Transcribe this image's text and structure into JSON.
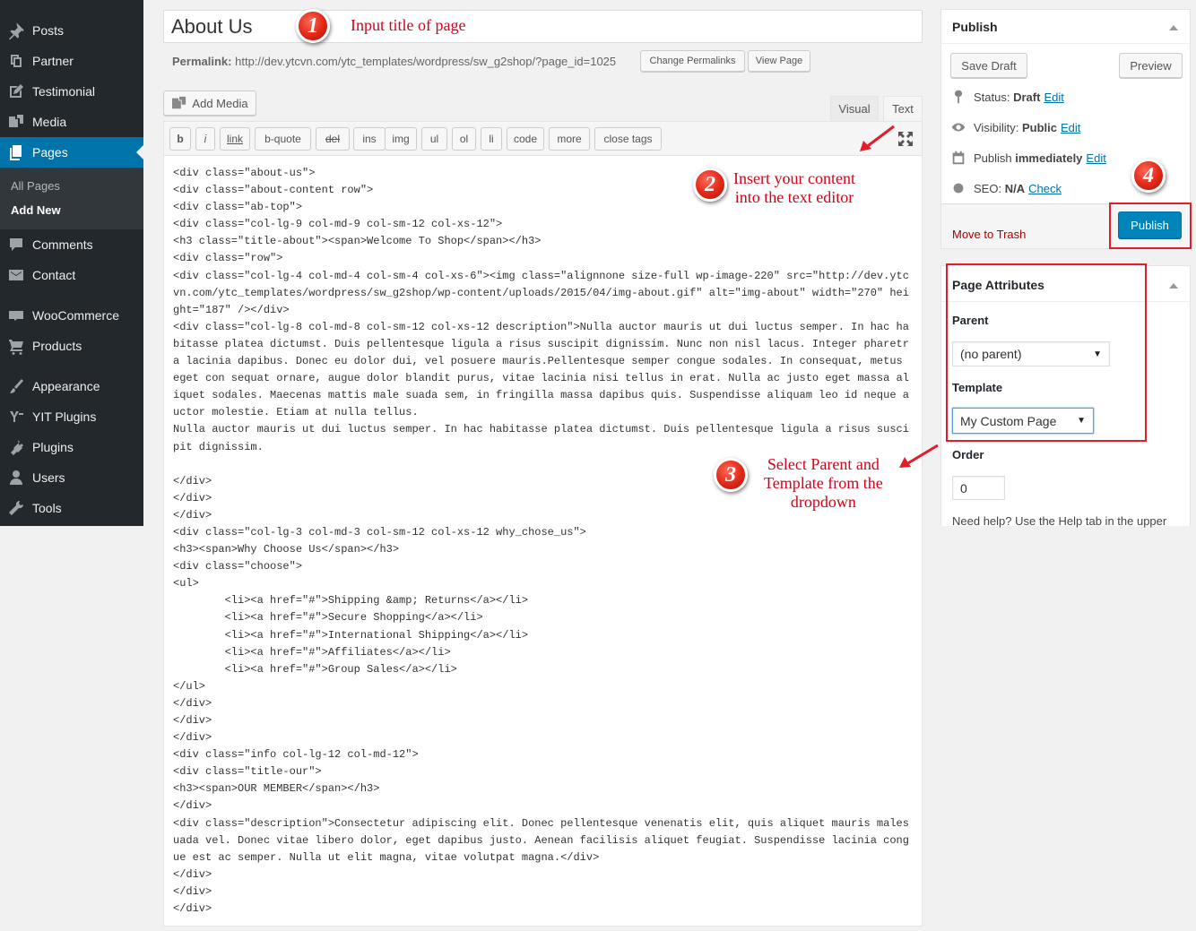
{
  "sidebar": {
    "items": [
      {
        "label": "Posts",
        "icon": "pin-icon"
      },
      {
        "label": "Partner",
        "icon": "copy-icon"
      },
      {
        "label": "Testimonial",
        "icon": "edit-icon"
      },
      {
        "label": "Media",
        "icon": "media-icon"
      },
      {
        "label": "Pages",
        "icon": "pages-icon"
      },
      {
        "label": "Comments",
        "icon": "comment-icon"
      },
      {
        "label": "Contact",
        "icon": "mail-icon"
      },
      {
        "label": "WooCommerce",
        "icon": "woo-icon"
      },
      {
        "label": "Products",
        "icon": "cart-icon"
      },
      {
        "label": "Appearance",
        "icon": "brush-icon"
      },
      {
        "label": "YIT Plugins",
        "icon": "yit-icon"
      },
      {
        "label": "Plugins",
        "icon": "plug-icon"
      },
      {
        "label": "Users",
        "icon": "user-icon"
      },
      {
        "label": "Tools",
        "icon": "wrench-icon"
      }
    ],
    "submenu": [
      "All Pages",
      "Add New"
    ]
  },
  "editor": {
    "title": "About Us",
    "permalink_label": "Permalink:",
    "permalink_url": "http://dev.ytcvn.com/ytc_templates/wordpress/sw_g2shop/?page_id=1025",
    "change_permalinks": "Change Permalinks",
    "view_page": "View Page",
    "add_media": "Add Media",
    "tab_visual": "Visual",
    "tab_text": "Text",
    "toolbar": [
      "b",
      "i",
      "link",
      "b-quote",
      "del",
      "ins",
      "img",
      "ul",
      "ol",
      "li",
      "code",
      "more",
      "close tags"
    ],
    "content": "<div class=\"about-us\">\n<div class=\"about-content row\">\n<div class=\"ab-top\">\n<div class=\"col-lg-9 col-md-9 col-sm-12 col-xs-12\">\n<h3 class=\"title-about\"><span>Welcome To Shop</span></h3>\n<div class=\"row\">\n<div class=\"col-lg-4 col-md-4 col-sm-4 col-xs-6\"><img class=\"alignnone size-full wp-image-220\" src=\"http://dev.ytcvn.com/ytc_templates/wordpress/sw_g2shop/wp-content/uploads/2015/04/img-about.gif\" alt=\"img-about\" width=\"270\" height=\"187\" /></div>\n<div class=\"col-lg-8 col-md-8 col-sm-12 col-xs-12 description\">Nulla auctor mauris ut dui luctus semper. In hac habitasse platea dictumst. Duis pellentesque ligula a risus suscipit dignissim. Nunc non nisl lacus. Integer pharetra lacinia dapibus. Donec eu dolor dui, vel posuere mauris.Pellentesque semper congue sodales. In consequat, metus eget con sequat ornare, augue dolor blandit purus, vitae lacinia nisi tellus in erat. Nulla ac justo eget massa aliquet sodales. Maecenas mattis male suada sem, in fringilla massa dapibus quis. Suspendisse aliquam leo id neque auctor molestie. Etiam at nulla tellus.\nNulla auctor mauris ut dui luctus semper. In hac habitasse platea dictumst. Duis pellentesque ligula a risus suscipit dignissim.\n\n</div>\n</div>\n</div>\n<div class=\"col-lg-3 col-md-3 col-sm-12 col-xs-12 why_chose_us\">\n<h3><span>Why Choose Us</span></h3>\n<div class=\"choose\">\n<ul>\n        <li><a href=\"#\">Shipping &amp; Returns</a></li>\n        <li><a href=\"#\">Secure Shopping</a></li>\n        <li><a href=\"#\">International Shipping</a></li>\n        <li><a href=\"#\">Affiliates</a></li>\n        <li><a href=\"#\">Group Sales</a></li>\n</ul>\n</div>\n</div>\n</div>\n<div class=\"info col-lg-12 col-md-12\">\n<div class=\"title-our\">\n<h3><span>OUR MEMBER</span></h3>\n</div>\n<div class=\"description\">Consectetur adipiscing elit. Donec pellentesque venenatis elit, quis aliquet mauris malesuada vel. Donec vitae libero dolor, eget dapibus justo. Aenean facilisis aliquet feugiat. Suspendisse lacinia congue est ac semper. Nulla ut elit magna, vitae volutpat magna.</div>\n</div>\n</div>\n</div>"
  },
  "annotations": {
    "step1": {
      "number": "1",
      "text": "Input title of page"
    },
    "step2": {
      "number": "2",
      "text": "Insert your content\ninto the text editor"
    },
    "step3": {
      "number": "3",
      "text": "Select Parent and\nTemplate from the\ndropdown"
    },
    "step4": {
      "number": "4"
    }
  },
  "publish": {
    "title": "Publish",
    "save_draft": "Save Draft",
    "preview": "Preview",
    "status_label": "Status:",
    "status_value": "Draft",
    "visibility_label": "Visibility:",
    "visibility_value": "Public",
    "publish_label": "Publish",
    "publish_value": "immediately",
    "seo_label": "SEO:",
    "seo_value": "N/A",
    "edit": "Edit",
    "check": "Check",
    "move_to_trash": "Move to Trash",
    "publish_button": "Publish"
  },
  "page_attributes": {
    "title": "Page Attributes",
    "parent_label": "Parent",
    "parent_value": "(no parent)",
    "template_label": "Template",
    "template_value": "My Custom Page",
    "order_label": "Order",
    "order_value": "0",
    "help_text": "Need help? Use the Help tab in the upper"
  },
  "colors": {
    "sidebar_bg": "#23282d",
    "accent": "#0073aa",
    "publish_button": "#0085ba",
    "annotation_red": "#e31d2b"
  }
}
